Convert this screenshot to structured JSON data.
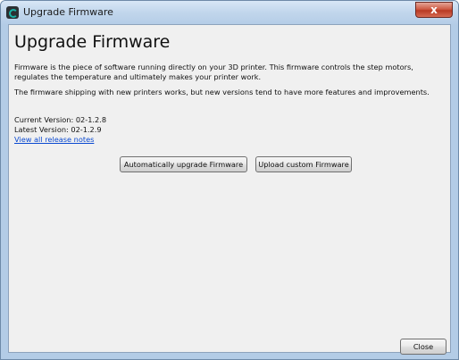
{
  "window": {
    "title": "Upgrade Firmware",
    "close_glyph": "x"
  },
  "main": {
    "heading": "Upgrade Firmware",
    "paragraph1": "Firmware is the piece of software running directly on your 3D printer. This firmware controls the step motors, regulates the temperature and ultimately makes your printer work.",
    "paragraph2": "The firmware shipping with new printers works, but new versions tend to have more features and improvements.",
    "current_version": "Current Version: 02-1.2.8",
    "latest_version": "Latest Version: 02-1.2.9",
    "release_notes_link": "View all release notes"
  },
  "buttons": {
    "auto_upgrade": "Automatically upgrade Firmware",
    "upload_custom": "Upload custom Firmware",
    "close": "Close"
  }
}
